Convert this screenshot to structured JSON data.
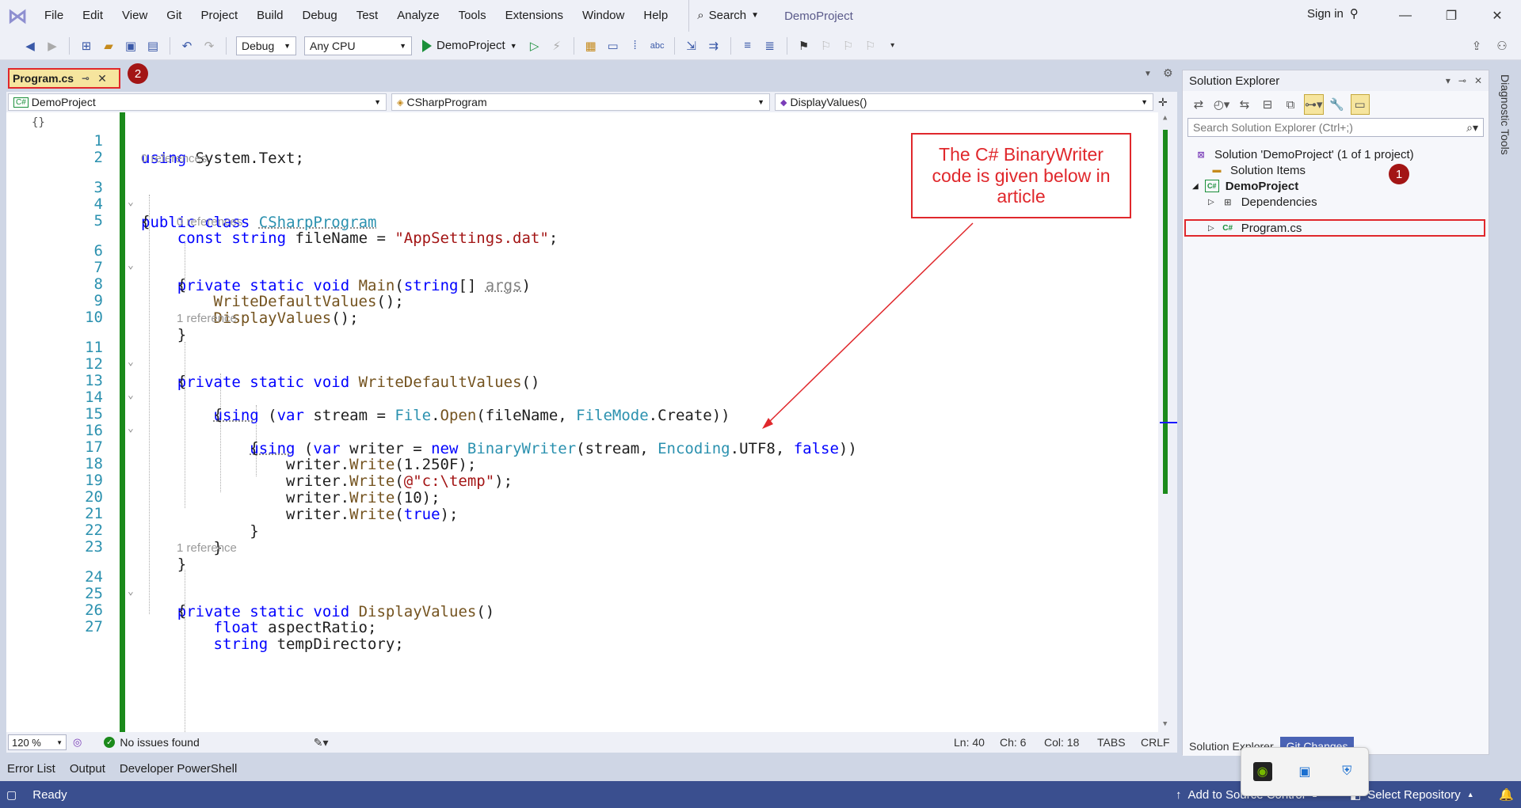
{
  "menu": {
    "items": [
      "File",
      "Edit",
      "View",
      "Git",
      "Project",
      "Build",
      "Debug",
      "Test",
      "Analyze",
      "Tools",
      "Extensions",
      "Window",
      "Help"
    ],
    "search_label": "Search",
    "project_name": "DemoProject",
    "sign_in": "Sign in"
  },
  "toolbar": {
    "config": "Debug",
    "platform": "Any CPU",
    "run_target": "DemoProject"
  },
  "doc_tab": {
    "label": "Program.cs"
  },
  "badges": {
    "tab_step": "2",
    "tree_step": "1"
  },
  "navbar": {
    "project": "DemoProject",
    "class": "CSharpProgram",
    "member": "DisplayValues()"
  },
  "editor": {
    "ref_zero": "0 references",
    "ref_one": "1 reference",
    "lines": [
      "1",
      "2",
      "3",
      "4",
      "5",
      "6",
      "7",
      "8",
      "9",
      "10",
      "11",
      "12",
      "13",
      "14",
      "15",
      "16",
      "17",
      "18",
      "19",
      "20",
      "21",
      "22",
      "23",
      "24",
      "25",
      "26",
      "27"
    ]
  },
  "callout": {
    "text": "The C# BinaryWriter code is given below in article"
  },
  "editor_status": {
    "zoom": "120 %",
    "issues": "No issues found",
    "ln": "Ln: 40",
    "ch": "Ch: 6",
    "col": "Col: 18",
    "tabs": "TABS",
    "eol": "CRLF"
  },
  "solution_explorer": {
    "title": "Solution Explorer",
    "search_placeholder": "Search Solution Explorer (Ctrl+;)",
    "solution": "Solution 'DemoProject' (1 of 1 project)",
    "solution_items": "Solution Items",
    "project": "DemoProject",
    "dependencies": "Dependencies",
    "file": "Program.cs",
    "tabs": [
      "Solution Explorer",
      "Git Changes"
    ]
  },
  "diagnostic_tools": "Diagnostic Tools",
  "bottom_tabs": [
    "Error List",
    "Output",
    "Developer PowerShell"
  ],
  "statusbar": {
    "ready": "Ready",
    "add_source": "Add to Source Control",
    "select_repo": "Select Repository"
  },
  "colors": {
    "accent": "#3a4f8f",
    "highlight": "#e0282c",
    "margin_green": "#1b8a1b"
  }
}
